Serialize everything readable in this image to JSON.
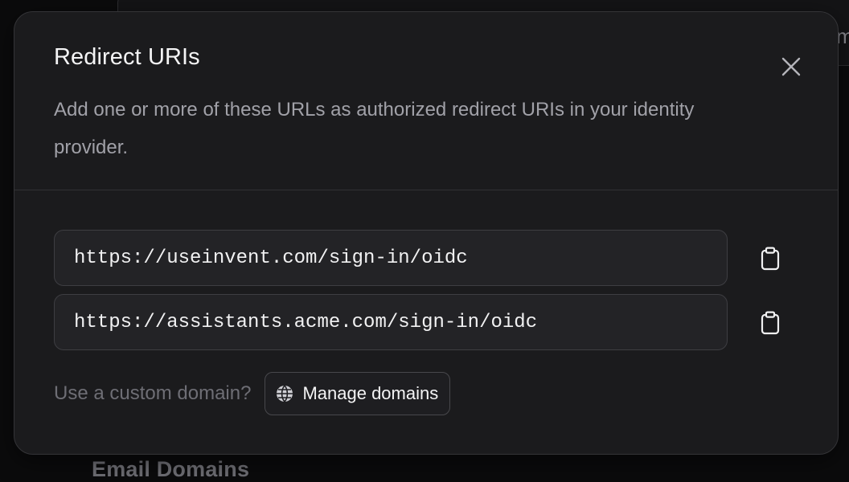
{
  "dialog": {
    "title": "Redirect URIs",
    "description": "Add one or more of these URLs as authorized redirect URIs in your identity provider.",
    "close_icon": "close-icon",
    "redirect_uris": [
      {
        "value": "https://useinvent.com/sign-in/oidc",
        "copy_icon": "clipboard-icon"
      },
      {
        "value": "https://assistants.acme.com/sign-in/oidc",
        "copy_icon": "clipboard-icon"
      }
    ],
    "custom_domain": {
      "prompt": "Use a custom domain?",
      "button_label": "Manage domains",
      "button_icon": "globe-icon"
    }
  },
  "background": {
    "heading_partial": "Email Domains",
    "panel_glyph": "m"
  },
  "colors": {
    "dialog_bg": "#1b1b1d",
    "page_bg": "#0b0b0c",
    "border": "#343437",
    "text_primary": "#f4f4f5",
    "text_secondary": "#a1a1a8",
    "text_muted": "#6e6e75"
  }
}
